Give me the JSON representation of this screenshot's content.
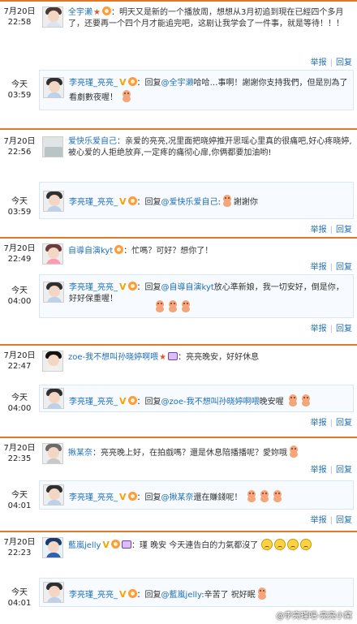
{
  "actions": {
    "report": "举报",
    "reply": "回复"
  },
  "threads": [
    {
      "date": "7月20日",
      "time": "22:58",
      "user": "全宇濑",
      "message": "明天又是新的一个播放周，想想从3月初追到現在已經四个多月了，还要再一个四个月才能追完吧，这剧让我学会了一件事，就是等待！！！",
      "reply": {
        "date": "今天",
        "time": "03:59",
        "user": "李亮瑾_亮亮_",
        "prefix": "回复",
        "to": "@全宇濑",
        "text": "哈哈…事啊！謝謝你支持我們，但是別為了看劇數夜喔！",
        "emoji_count": 1
      }
    },
    {
      "date": "7月20日",
      "time": "22:56",
      "user": "爱快乐爱自己",
      "message": "亲爱的亮亮,况里面把晓婷推开思瑶心里真的很痛吧,好心疼晓婷,被心爱的人拒绝放弃,一定疼的痛彻心扉,你俩都要加油哟!",
      "reply": {
        "date": "今天",
        "time": "03:59",
        "user": "李亮瑾_亮亮_",
        "prefix": "回复",
        "to": "@爱快乐爱自己",
        "text": "謝謝你",
        "emoji_count": 1
      }
    },
    {
      "date": "7月20日",
      "time": "22:49",
      "user": "自導自演kyt",
      "message": "忙嗎？可好？想你了！",
      "reply": {
        "date": "今天",
        "time": "04:00",
        "user": "李亮瑾_亮亮_",
        "prefix": "回复",
        "to": "@自導自演kyt",
        "text": "放心準新娘，我一切安好，倒是你，好好保重喔！",
        "emoji_count": 3
      }
    },
    {
      "date": "7月20日",
      "time": "22:47",
      "user": "zoe-我不想叫孙晓婷啊喂",
      "message": "亮亮晚安，好好休息",
      "reply": {
        "date": "今天",
        "time": "04:00",
        "user": "李亮瑾_亮亮_",
        "prefix": "回复",
        "to": "@zoe-我不想叫孙晓婷啊喂",
        "text": "晚安喔",
        "emoji_count": 2
      }
    },
    {
      "date": "7月20日",
      "time": "22:35",
      "user": "揪某奈",
      "message": "亮亮晚上好，在拍戲嗎？還是休息陪播播呢？愛妳哦",
      "reply": {
        "date": "今天",
        "time": "04:01",
        "user": "李亮瑾_亮亮_",
        "prefix": "回复",
        "to": "@揪某奈",
        "text": "還在賺錢呢！",
        "emoji_count": 3
      }
    },
    {
      "date": "7月20日",
      "time": "22:23",
      "user": "藍嵐jelly",
      "message": "瑾 晚安 今天連告白的力氣都沒了",
      "reply": {
        "date": "今天",
        "time": "04:01",
        "user": "李亮瑾_亮亮_",
        "prefix": "回复",
        "to": "@藍嵐jelly",
        "text": "辛苦了 祝好眠",
        "emoji_count": 1
      }
    }
  ],
  "watermark": "@李亮瑾吧-亮亮小窝"
}
